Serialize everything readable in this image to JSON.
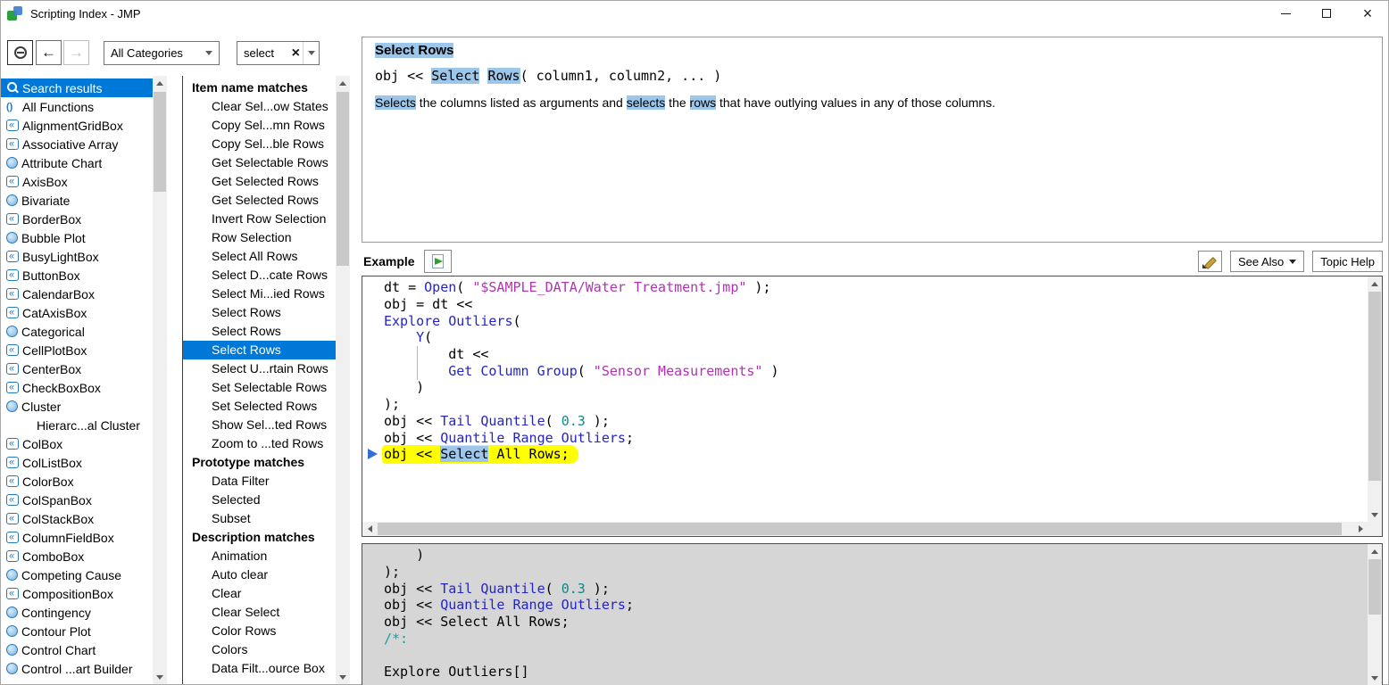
{
  "window": {
    "title": "Scripting Index - JMP"
  },
  "toolbar": {
    "category_value": "All Categories",
    "search_value": "select"
  },
  "icons": {
    "app-icon": "jmp-logo-blocks",
    "minimize-icon": "bar",
    "maximize-icon": "square",
    "close-icon": "×",
    "minus-circle-icon": "circled-minus",
    "back-arrow-icon": "←",
    "forward-arrow-icon": "→",
    "chevron-down-icon": "▼",
    "clear-search-icon": "×",
    "search-icon": "magnifier",
    "functions-icon": "()",
    "display-box-icon": "«",
    "platform-icon": "blue-circle",
    "run-script-icon": "page-with-green-arrow",
    "edit-script-icon": "pencil",
    "execution-marker-icon": "blue-right-arrow",
    "scroll-up-icon": "▲",
    "scroll-down-icon": "▼",
    "scroll-left-icon": "◄",
    "scroll-right-icon": "►"
  },
  "colors": {
    "selection": "#0078d7",
    "term_highlight": "#9cc7ea",
    "line_highlight": "#ffff00",
    "code_function": "#2424c8",
    "code_string": "#b232b2",
    "code_number": "#0b8989",
    "code_marker": "#18a0a0"
  },
  "sidebar": {
    "items": [
      {
        "label": "Search results",
        "icon": "search",
        "selected": true
      },
      {
        "label": "All Functions",
        "icon": "paren"
      },
      {
        "label": "AlignmentGridBox",
        "icon": "box"
      },
      {
        "label": "Associative Array",
        "icon": "box"
      },
      {
        "label": "Attribute Chart",
        "icon": "circle"
      },
      {
        "label": "AxisBox",
        "icon": "box"
      },
      {
        "label": "Bivariate",
        "icon": "circle"
      },
      {
        "label": "BorderBox",
        "icon": "box"
      },
      {
        "label": "Bubble Plot",
        "icon": "circle"
      },
      {
        "label": "BusyLightBox",
        "icon": "box"
      },
      {
        "label": "ButtonBox",
        "icon": "box"
      },
      {
        "label": "CalendarBox",
        "icon": "box"
      },
      {
        "label": "CatAxisBox",
        "icon": "box"
      },
      {
        "label": "Categorical",
        "icon": "circle"
      },
      {
        "label": "CellPlotBox",
        "icon": "box"
      },
      {
        "label": "CenterBox",
        "icon": "box"
      },
      {
        "label": "CheckBoxBox",
        "icon": "box"
      },
      {
        "label": "Cluster",
        "icon": "circle"
      },
      {
        "label": "Hierarc...al Cluster",
        "icon": "none",
        "indent": true
      },
      {
        "label": "ColBox",
        "icon": "box"
      },
      {
        "label": "ColListBox",
        "icon": "box"
      },
      {
        "label": "ColorBox",
        "icon": "box"
      },
      {
        "label": "ColSpanBox",
        "icon": "box"
      },
      {
        "label": "ColStackBox",
        "icon": "box"
      },
      {
        "label": "ColumnFieldBox",
        "icon": "box"
      },
      {
        "label": "ComboBox",
        "icon": "box"
      },
      {
        "label": "Competing Cause",
        "icon": "circle"
      },
      {
        "label": "CompositionBox",
        "icon": "box"
      },
      {
        "label": "Contingency",
        "icon": "circle"
      },
      {
        "label": "Contour Plot",
        "icon": "circle"
      },
      {
        "label": "Control Chart",
        "icon": "circle"
      },
      {
        "label": "Control ...art Builder",
        "icon": "circle"
      }
    ]
  },
  "matches": {
    "sections": [
      {
        "header": "Item name matches",
        "selected_index": 13,
        "items": [
          "Clear Sel...ow States",
          "Copy Sel...mn Rows",
          "Copy Sel...ble Rows",
          "Get Selectable Rows",
          "Get Selected Rows",
          "Get Selected Rows",
          "Invert Row Selection",
          "Row Selection",
          "Select All Rows",
          "Select D...cate Rows",
          "Select Mi...ied Rows",
          "Select Rows",
          "Select Rows",
          "Select Rows",
          "Select U...rtain Rows",
          "Set Selectable Rows",
          "Set Selected Rows",
          "Show Sel...ted Rows",
          "Zoom to ...ted Rows"
        ]
      },
      {
        "header": "Prototype matches",
        "selected_index": -1,
        "items": [
          "Data Filter",
          "Selected",
          "Subset"
        ]
      },
      {
        "header": "Description matches",
        "selected_index": -1,
        "items": [
          "Animation",
          "Auto clear",
          "Clear",
          "Clear Select",
          "Color Rows",
          "Colors",
          "Data Filt...ource Box"
        ]
      }
    ]
  },
  "detail": {
    "title": "Select Rows",
    "signature": [
      {
        "t": "obj << "
      },
      {
        "t": "Select",
        "hl": true
      },
      {
        "t": " "
      },
      {
        "t": "Rows",
        "hl": true
      },
      {
        "t": "( column1, column2, ... )"
      }
    ],
    "description": [
      {
        "t": "Selects",
        "hl": true
      },
      {
        "t": " the columns listed as arguments and "
      },
      {
        "t": "selects",
        "hl": true
      },
      {
        "t": " the "
      },
      {
        "t": "rows",
        "hl": true
      },
      {
        "t": " that have outlying values in any of those columns."
      }
    ]
  },
  "example": {
    "label": "Example",
    "see_also_label": "See Also",
    "topic_help_label": "Topic Help"
  },
  "code_editor": {
    "lines": [
      {
        "indent": 0,
        "seg": [
          {
            "t": "dt = "
          },
          {
            "t": "Open",
            "c": "f"
          },
          {
            "t": "( "
          },
          {
            "t": "\"$SAMPLE_DATA/Water Treatment.jmp\"",
            "c": "s"
          },
          {
            "t": " );"
          }
        ]
      },
      {
        "indent": 0,
        "seg": [
          {
            "t": "obj = dt <<"
          }
        ]
      },
      {
        "indent": 0,
        "seg": [
          {
            "t": "Explore Outliers",
            "c": "f"
          },
          {
            "t": "("
          }
        ]
      },
      {
        "indent": 4,
        "seg": [
          {
            "t": "Y",
            "c": "f"
          },
          {
            "t": "("
          }
        ]
      },
      {
        "indent": 8,
        "seg": [
          {
            "t": "dt <<"
          }
        ]
      },
      {
        "indent": 8,
        "seg": [
          {
            "t": "Get Column Group",
            "c": "f"
          },
          {
            "t": "( "
          },
          {
            "t": "\"Sensor Measurements\"",
            "c": "s"
          },
          {
            "t": " )"
          }
        ]
      },
      {
        "indent": 4,
        "seg": [
          {
            "t": ")"
          }
        ]
      },
      {
        "indent": 0,
        "seg": [
          {
            "t": ");"
          }
        ]
      },
      {
        "indent": 0,
        "seg": [
          {
            "t": "obj << "
          },
          {
            "t": "Tail Quantile",
            "c": "f"
          },
          {
            "t": "( "
          },
          {
            "t": "0.3",
            "c": "n"
          },
          {
            "t": " );"
          }
        ]
      },
      {
        "indent": 0,
        "seg": [
          {
            "t": "obj << "
          },
          {
            "t": "Quantile Range Outliers",
            "c": "f"
          },
          {
            "t": ";"
          }
        ]
      },
      {
        "indent": 0,
        "marker": true,
        "hl_line": true,
        "seg": [
          {
            "t": "obj << "
          },
          {
            "t": "Select",
            "hl": true
          },
          {
            "t": " All Rows;"
          }
        ]
      }
    ]
  },
  "log": {
    "lines": [
      {
        "indent": 4,
        "seg": [
          {
            "t": ")"
          }
        ]
      },
      {
        "indent": 0,
        "seg": [
          {
            "t": ");"
          }
        ]
      },
      {
        "indent": 0,
        "seg": [
          {
            "t": "obj << "
          },
          {
            "t": "Tail Quantile",
            "c": "f"
          },
          {
            "t": "( "
          },
          {
            "t": "0.3",
            "c": "n"
          },
          {
            "t": " );"
          }
        ]
      },
      {
        "indent": 0,
        "seg": [
          {
            "t": "obj << "
          },
          {
            "t": "Quantile Range Outliers",
            "c": "f"
          },
          {
            "t": ";"
          }
        ]
      },
      {
        "indent": 0,
        "seg": [
          {
            "t": "obj << Select All Rows;"
          }
        ]
      },
      {
        "indent": 0,
        "seg": [
          {
            "t": "/*:",
            "c": "c"
          }
        ]
      },
      {
        "indent": 0,
        "seg": []
      },
      {
        "indent": 0,
        "seg": [
          {
            "t": "Explore Outliers[]"
          }
        ]
      }
    ]
  }
}
